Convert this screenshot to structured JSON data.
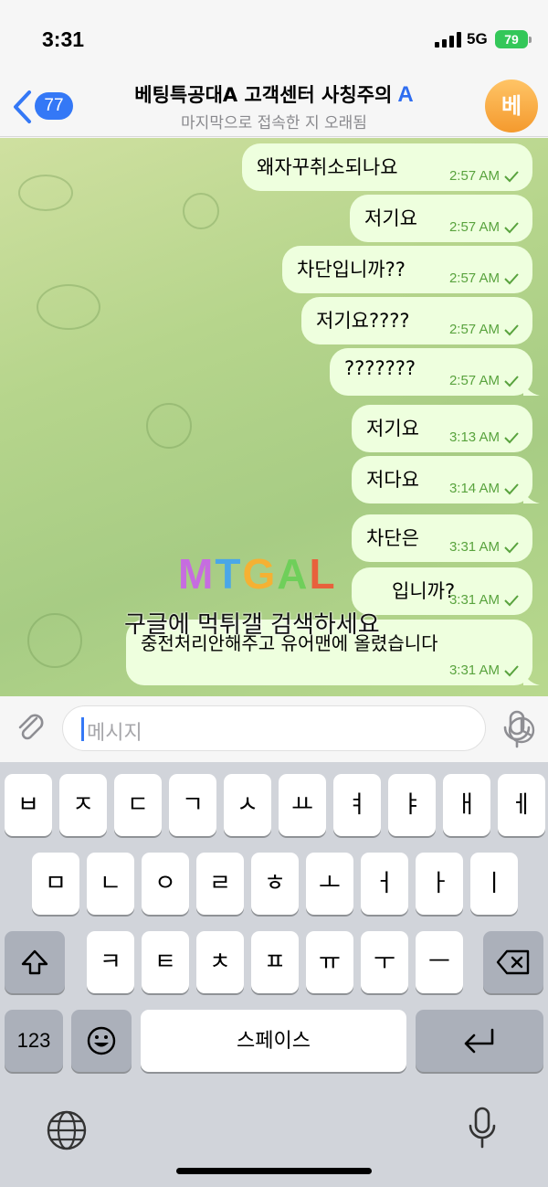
{
  "status_bar": {
    "time": "3:31",
    "network": "5G",
    "battery": "79"
  },
  "header": {
    "back_count": "77",
    "title": "베팅특공대A 고객센터 사칭주의",
    "title_badge": "A",
    "subtitle": "마지막으로 접속한 지 오래됨",
    "avatar_letter": "베"
  },
  "messages": [
    {
      "text": "왜자꾸취소되나요",
      "time": "2:57 AM"
    },
    {
      "text": "저기요",
      "time": "2:57 AM"
    },
    {
      "text": "차단입니까??",
      "time": "2:57 AM"
    },
    {
      "text": "저기요????",
      "time": "2:57 AM"
    },
    {
      "text": "???????",
      "time": "2:57 AM"
    },
    {
      "text": "저기요",
      "time": "3:13 AM"
    },
    {
      "text": "저다요",
      "time": "3:14 AM"
    },
    {
      "text": "차단은",
      "time": "3:31 AM"
    },
    {
      "text": "입니까?",
      "time": "3:31 AM"
    },
    {
      "text": "중전처리안해주고 유어맨에 올렸습니다",
      "time": "3:31 AM"
    }
  ],
  "watermark": {
    "logo": "MTGAL",
    "caption": "구글에 먹튀갤 검색하세요"
  },
  "input": {
    "placeholder": "메시지"
  },
  "keyboard": {
    "row1": [
      "ㅂ",
      "ㅈ",
      "ㄷ",
      "ㄱ",
      "ㅅ",
      "ㅛ",
      "ㅕ",
      "ㅑ",
      "ㅐ",
      "ㅔ"
    ],
    "row2": [
      "ㅁ",
      "ㄴ",
      "ㅇ",
      "ㄹ",
      "ㅎ",
      "ㅗ",
      "ㅓ",
      "ㅏ",
      "ㅣ"
    ],
    "row3": [
      "ㅋ",
      "ㅌ",
      "ㅊ",
      "ㅍ",
      "ㅠ",
      "ㅜ",
      "ㅡ"
    ],
    "numbers_label": "123",
    "space_label": "스페이스"
  },
  "colors": {
    "accent": "#3478f6",
    "bubble": "#eeffde",
    "time_green": "#59a33e",
    "battery": "#34c759"
  }
}
